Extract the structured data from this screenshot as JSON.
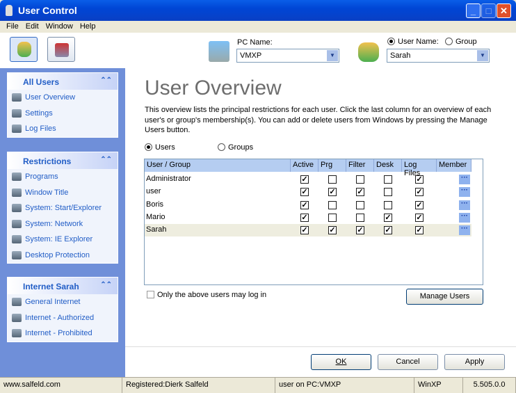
{
  "window": {
    "title": "User Control"
  },
  "menu": [
    "File",
    "Edit",
    "Window",
    "Help"
  ],
  "toolbar": {
    "pc_label": "PC Name:",
    "pc_value": "VMXP",
    "user_radio": "User Name:",
    "group_radio": "Group",
    "user_value": "Sarah"
  },
  "sidebar": [
    {
      "title": "All Users",
      "items": [
        "User Overview",
        "Settings",
        "Log Files"
      ]
    },
    {
      "title": "Restrictions",
      "items": [
        "Programs",
        "Window Title",
        "System: Start/Explorer",
        "System: Network",
        "System: IE Explorer",
        "Desktop Protection"
      ]
    },
    {
      "title": "Internet Sarah",
      "items": [
        "General Internet",
        "Internet - Authorized",
        "Internet - Prohibited"
      ]
    }
  ],
  "main": {
    "title": "User Overview",
    "description": "This overview lists the principal restrictions for each user. Click the last column for an overview of each user's or group's membership(s). You can add or delete users from Windows by pressing the Manage Users button.",
    "radio_users": "Users",
    "radio_groups": "Groups",
    "columns": [
      "User / Group",
      "Active",
      "Prg",
      "Filter",
      "Desk",
      "Log Files",
      "Member"
    ],
    "rows": [
      {
        "name": "Administrator",
        "flags": [
          true,
          false,
          false,
          false,
          true
        ]
      },
      {
        "name": "user",
        "flags": [
          true,
          true,
          true,
          false,
          true
        ]
      },
      {
        "name": "Boris",
        "flags": [
          true,
          false,
          false,
          false,
          true
        ]
      },
      {
        "name": "Mario",
        "flags": [
          true,
          false,
          false,
          true,
          true
        ]
      },
      {
        "name": "Sarah",
        "flags": [
          true,
          true,
          true,
          true,
          true
        ],
        "selected": true
      }
    ],
    "member_button": "···",
    "only_users_label": "Only the above users may log in",
    "manage_users": "Manage Users",
    "ok": "OK",
    "cancel": "Cancel",
    "apply": "Apply"
  },
  "status": [
    "www.salfeld.com",
    "Registered:Dierk Salfeld",
    "user on PC:VMXP",
    "WinXP",
    "5.505.0.0"
  ]
}
